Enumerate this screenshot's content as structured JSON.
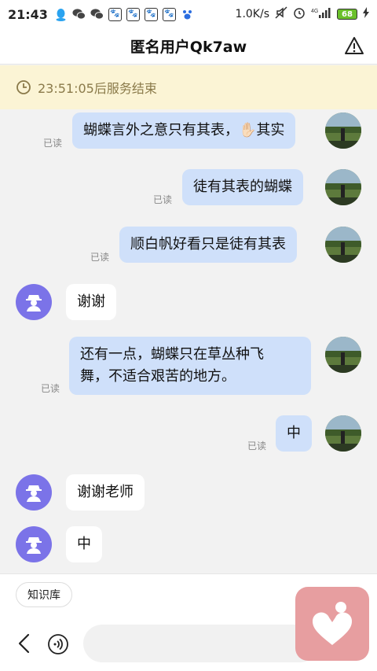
{
  "status_bar": {
    "time": "21:43",
    "net_speed": "1.0K/s",
    "network": "4G",
    "battery": "68"
  },
  "header": {
    "title": "匿名用户Qk7aw"
  },
  "banner": {
    "text": "23:51:05后服务结束"
  },
  "messages": [
    {
      "side": "out",
      "text": "蝴蝶言外之意只有其表，✋🏻其实",
      "read": "已读"
    },
    {
      "side": "out",
      "text": "徒有其表的蝴蝶",
      "read": "已读"
    },
    {
      "side": "out",
      "text": "顺白帆好看只是徒有其表",
      "read": "已读"
    },
    {
      "side": "in",
      "text": "谢谢"
    },
    {
      "side": "out",
      "text_line1": "还有一点，蝴蝶只在草丛种飞",
      "text_line2": "舞，不适合艰苦的地方。",
      "read": "已读"
    },
    {
      "side": "out",
      "text": "中",
      "read": "已读"
    },
    {
      "side": "in",
      "text": "谢谢老师"
    },
    {
      "side": "in",
      "text": "中"
    }
  ],
  "bottom": {
    "chip_label": "知识库"
  },
  "colors": {
    "outgoing_bubble": "#cfe0fa",
    "incoming_bubble": "#ffffff",
    "anon_avatar": "#7b73e8",
    "banner_bg": "#fbf4d5",
    "widget": "#e79ea0"
  }
}
